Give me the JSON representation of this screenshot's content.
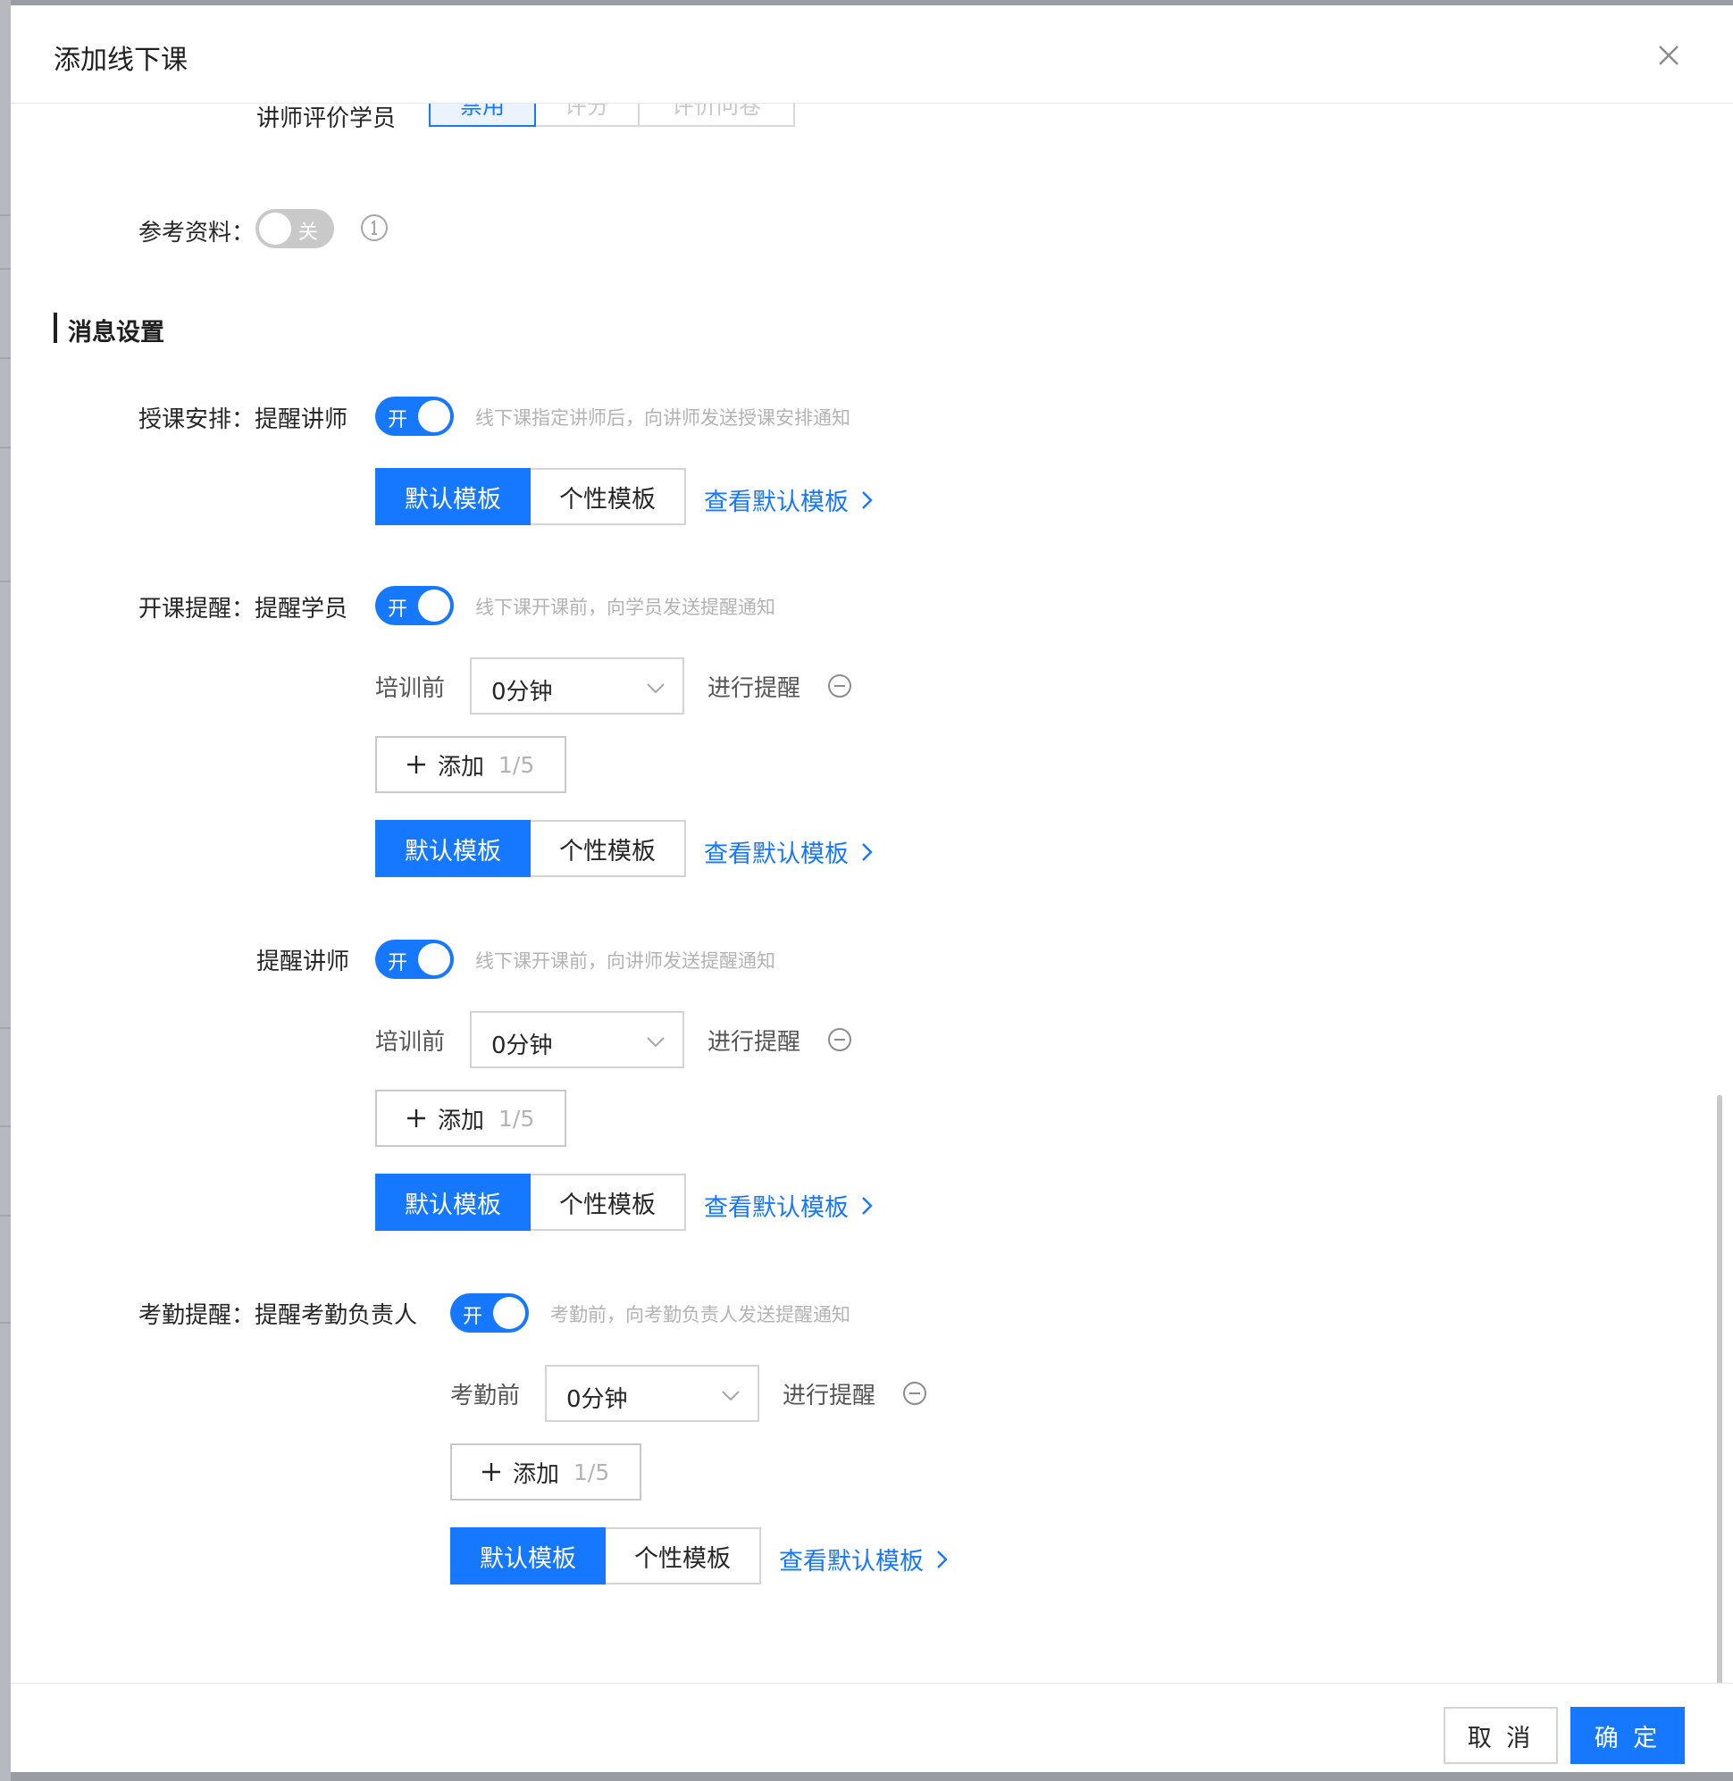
{
  "modal": {
    "title": "添加线下课"
  },
  "evaluation": {
    "label": "讲师评价学员",
    "options": [
      "禁用",
      "评分",
      "评价问卷"
    ],
    "selected": "禁用"
  },
  "reference": {
    "label": "参考资料：",
    "switch_text": "关",
    "state": "off"
  },
  "message_section": {
    "title": "消息设置"
  },
  "teaching_schedule": {
    "label": "授课安排：提醒讲师",
    "switch_text": "开",
    "hint": "线下课指定讲师后，向讲师发送授课安排通知",
    "template_default": "默认模板",
    "template_custom": "个性模板",
    "view_link": "查看默认模板"
  },
  "class_reminder_student": {
    "label": "开课提醒：提醒学员",
    "switch_text": "开",
    "hint": "线下课开课前，向学员发送提醒通知",
    "before_label": "培训前",
    "select_value": "0分钟",
    "after_label": "进行提醒",
    "add_label": "添加",
    "add_count": "1/5",
    "template_default": "默认模板",
    "template_custom": "个性模板",
    "view_link": "查看默认模板"
  },
  "class_reminder_teacher": {
    "label": "提醒讲师",
    "switch_text": "开",
    "hint": "线下课开课前，向讲师发送提醒通知",
    "before_label": "培训前",
    "select_value": "0分钟",
    "after_label": "进行提醒",
    "add_label": "添加",
    "add_count": "1/5",
    "template_default": "默认模板",
    "template_custom": "个性模板",
    "view_link": "查看默认模板"
  },
  "attendance_reminder": {
    "label": "考勤提醒：提醒考勤负责人",
    "switch_text": "开",
    "hint": "考勤前，向考勤负责人发送提醒通知",
    "before_label": "考勤前",
    "select_value": "0分钟",
    "after_label": "进行提醒",
    "add_label": "添加",
    "add_count": "1/5",
    "template_default": "默认模板",
    "template_custom": "个性模板",
    "view_link": "查看默认模板"
  },
  "footer": {
    "cancel_label": "取 消",
    "ok_label": "确 定"
  },
  "colors": {
    "primary": "#1677ff",
    "switch_off": "#c9c9c9"
  }
}
